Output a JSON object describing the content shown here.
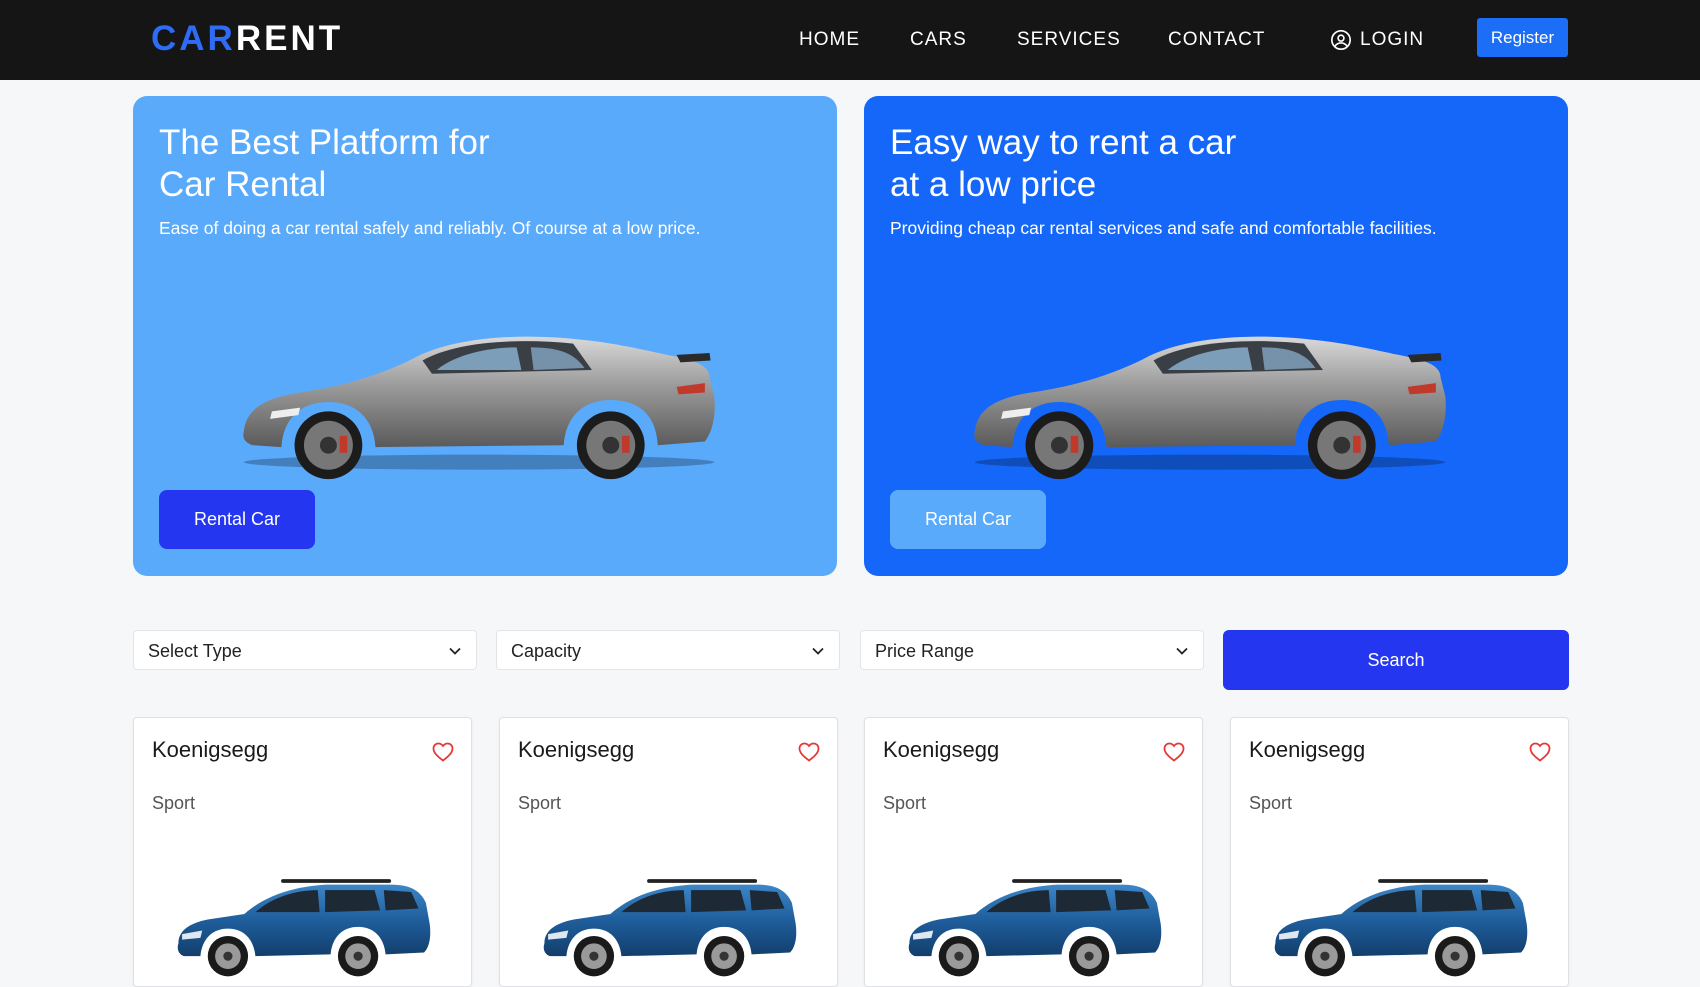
{
  "brand": {
    "part1": "CAR",
    "part2": "RENT"
  },
  "nav": {
    "links": [
      "HOME",
      "CARS",
      "SERVICES",
      "CONTACT"
    ],
    "login_label": "LOGIN",
    "register_label": "Register"
  },
  "heroes": [
    {
      "title": "The Best Platform for Car Rental",
      "subtitle": "Ease of doing a car rental safely and reliably. Of course at a low price.",
      "button_label": "Rental Car"
    },
    {
      "title": "Easy way to rent a car at a low price",
      "subtitle": "Providing cheap car rental services and safe and comfortable facilities.",
      "button_label": "Rental Car"
    }
  ],
  "filters": {
    "type_label": "Select Type",
    "capacity_label": "Capacity",
    "price_label": "Price Range",
    "search_label": "Search"
  },
  "cars": [
    {
      "name": "Koenigsegg",
      "category": "Sport"
    },
    {
      "name": "Koenigsegg",
      "category": "Sport"
    },
    {
      "name": "Koenigsegg",
      "category": "Sport"
    },
    {
      "name": "Koenigsegg",
      "category": "Sport"
    }
  ],
  "colors": {
    "navbar": "#151515",
    "brand_accent": "#2f6cf5",
    "hero_light": "#5aaafb",
    "hero_dark": "#1467f9",
    "primary_button": "#2436f0",
    "register_button": "#1b6ef5",
    "heart": "#e53935",
    "suv_body": "#1f5e9c"
  },
  "icons": {
    "login": "user-circle-icon",
    "select_arrow": "chevron-down-icon",
    "favorite": "heart-icon",
    "hero_image": "sports-car-icon",
    "card_image": "suv-car-icon"
  }
}
